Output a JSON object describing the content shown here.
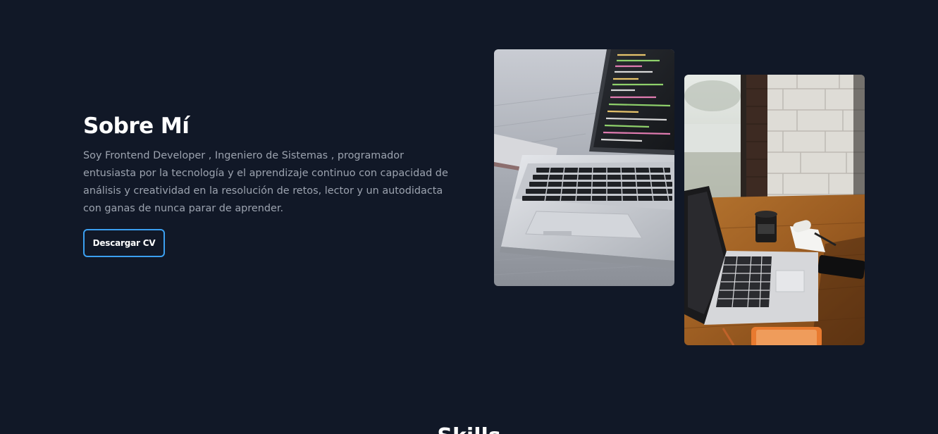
{
  "about": {
    "title": "Sobre Mí",
    "description": "Soy Frontend Developer , Ingeniero de Sistemas , programador entusiasta por la tecnología y el aprendizaje continuo con capacidad de análisis y creatividad en la resolución de retos, lector y un autodidacta con ganas de nunca parar de aprender.",
    "cv_button_label": "Descargar CV"
  },
  "images": [
    {
      "icon": "laptop-code-photo"
    },
    {
      "icon": "desk-laptop-coffee-photo"
    }
  ],
  "skills": {
    "title": "Skills"
  },
  "colors": {
    "background": "#111827",
    "accent": "#3b9ff0",
    "text_muted": "#9ca3af"
  }
}
